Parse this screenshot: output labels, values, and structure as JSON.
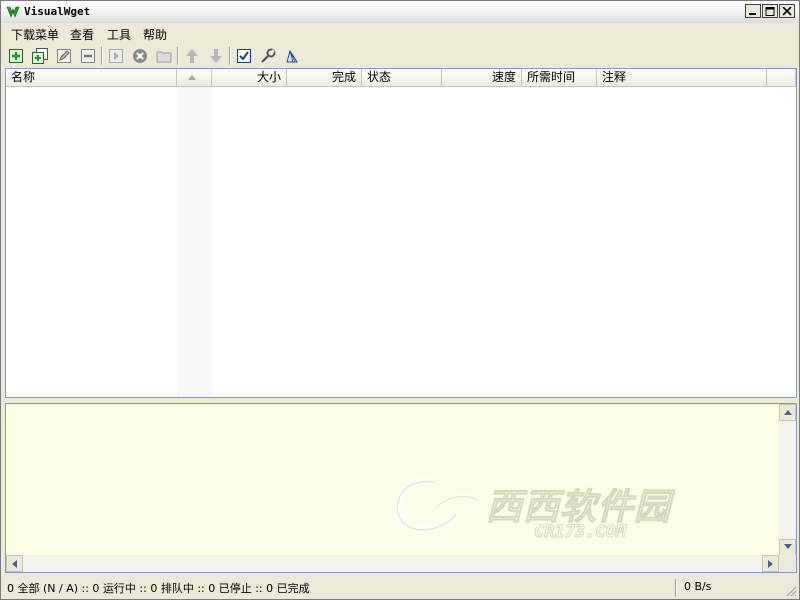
{
  "window": {
    "title": "VisualWget"
  },
  "menu": [
    "下载菜单",
    "查看",
    "工具",
    "帮助"
  ],
  "toolbar": {
    "icons": [
      "add-icon",
      "add-batch-icon",
      "edit-icon",
      "remove-icon",
      "start-icon",
      "stop-icon",
      "open-folder-icon",
      "move-up-icon",
      "move-down-icon",
      "select-all-icon",
      "options-icon",
      "clean-icon"
    ]
  },
  "list": {
    "columns": {
      "name": "名称",
      "size": "大小",
      "done": "完成",
      "status": "状态",
      "speed": "速度",
      "time": "所需时间",
      "notes": "注释"
    }
  },
  "log": {
    "watermark": "西西软件园",
    "watermark_sub": "CR173.COM"
  },
  "status": {
    "summary": "0 全部 (N / A) :: 0 运行中 :: 0 排队中 :: 0 已停止 :: 0 已完成",
    "rate": "0 B/s"
  },
  "colors": {
    "log_bg": "#fefee6",
    "accent": "#2a8a2a"
  }
}
